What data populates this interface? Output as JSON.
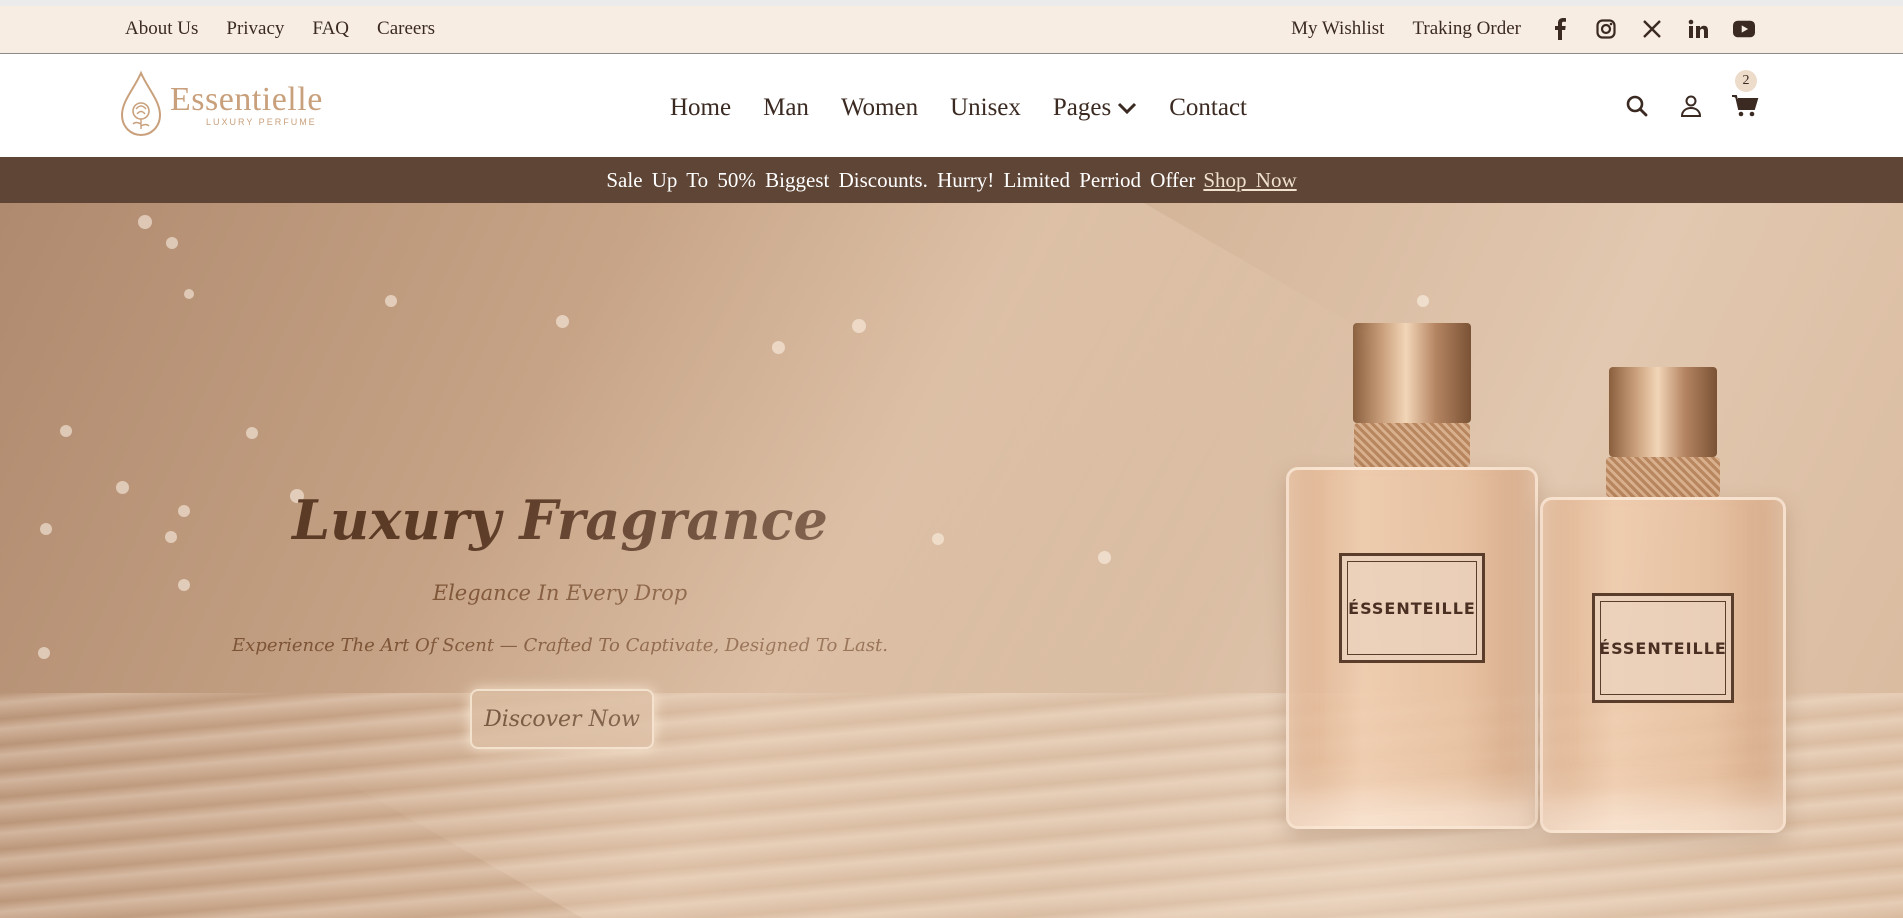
{
  "topbar": {
    "links": [
      "About Us",
      "Privacy",
      "FAQ",
      "Careers"
    ],
    "wishlist": "My Wishlist",
    "tracking": "Traking Order",
    "socials": [
      "facebook-icon",
      "instagram-icon",
      "x-icon",
      "linkedin-icon",
      "youtube-icon"
    ]
  },
  "brand": {
    "name": "Essentielle",
    "tagline": "LUXURY PERFUME",
    "color": "#c9a07c"
  },
  "nav": {
    "items": [
      "Home",
      "Man",
      "Women",
      "Unisex",
      "Pages",
      "Contact"
    ]
  },
  "cart": {
    "count": "2"
  },
  "promo": {
    "text": "Sale Up To 50% Biggest Discounts. Hurry! Limited Perriod Offer",
    "link": "Shop Now",
    "background": "#5e4536"
  },
  "hero": {
    "title": "Luxury Fragrance",
    "subtitle": "Elegance In Every Drop",
    "description": "Experience The Art Of Scent — Crafted To Captivate, Designed To Last.",
    "button": "Discover Now",
    "bottle_label_1": "ÉSSENTEILLE",
    "bottle_label_2": "ÉSSENTEILLE"
  }
}
